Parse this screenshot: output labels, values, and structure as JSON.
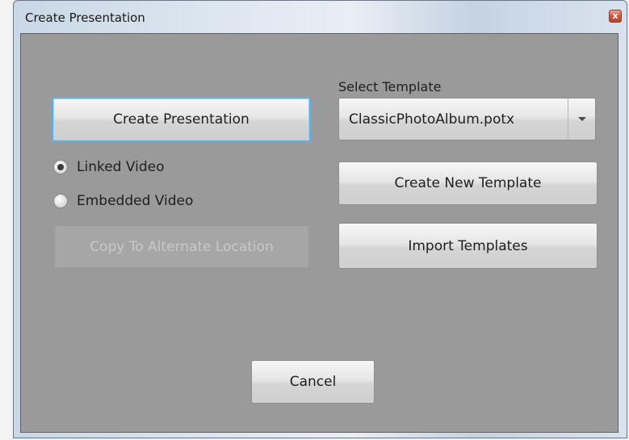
{
  "window": {
    "title": "Create Presentation",
    "close_glyph": "x"
  },
  "main": {
    "create_presentation_label": "Create Presentation",
    "linked_video_label": "Linked Video",
    "embedded_video_label": "Embedded Video",
    "video_mode_selected": "Linked Video",
    "copy_alternate_label": "Copy To Alternate Location",
    "select_template_label": "Select Template",
    "template_value": "ClassicPhotoAlbum.potx",
    "create_new_template_label": "Create New Template",
    "import_templates_label": "Import Templates",
    "cancel_label": "Cancel"
  },
  "colors": {
    "client_background": "#9a9a9a",
    "focus_border": "#5fb0e8",
    "close_button": "#c9583f"
  },
  "icons": {
    "close": "close-icon",
    "dropdown": "chevron-down-icon"
  }
}
